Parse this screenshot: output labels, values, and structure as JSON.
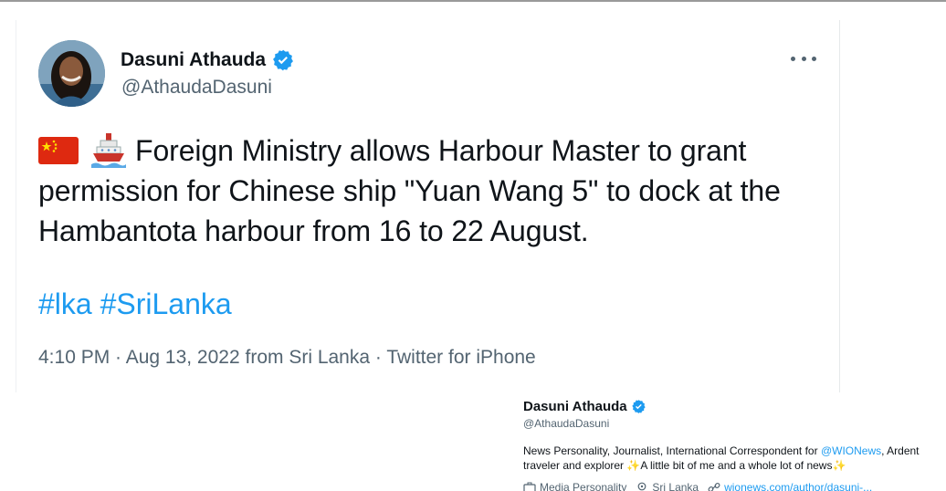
{
  "tweet": {
    "author_name": "Dasuni Athauda",
    "author_handle": "@AthaudaDasuni",
    "text": "Foreign Ministry allows Harbour Master to grant permission for Chinese ship \"Yuan Wang 5\" to dock at the Hambantota harbour from 16 to 22 August.",
    "flag_emoji": "china-flag-icon",
    "ship_emoji": "ship-icon",
    "hashtags": [
      "#lka",
      "#SriLanka"
    ],
    "meta": "4:10 PM · Aug 13, 2022 from Sri Lanka · Twitter for iPhone"
  },
  "profile_card": {
    "name": "Dasuni Athauda",
    "handle": "@AthaudaDasuni",
    "bio_prefix": "News Personality, Journalist, International Correspondent for ",
    "bio_mention": "@WIONews",
    "bio_mid": ", Ardent traveler and explorer ",
    "bio_mid2": "A little bit of me and a whole lot of news",
    "category": "Media Personality",
    "location": "Sri Lanka",
    "url": "wionews.com/author/dasuni-..."
  },
  "colors": {
    "link": "#1d9bf0",
    "verified": "#1d9bf0",
    "secondary_text": "#536471"
  }
}
